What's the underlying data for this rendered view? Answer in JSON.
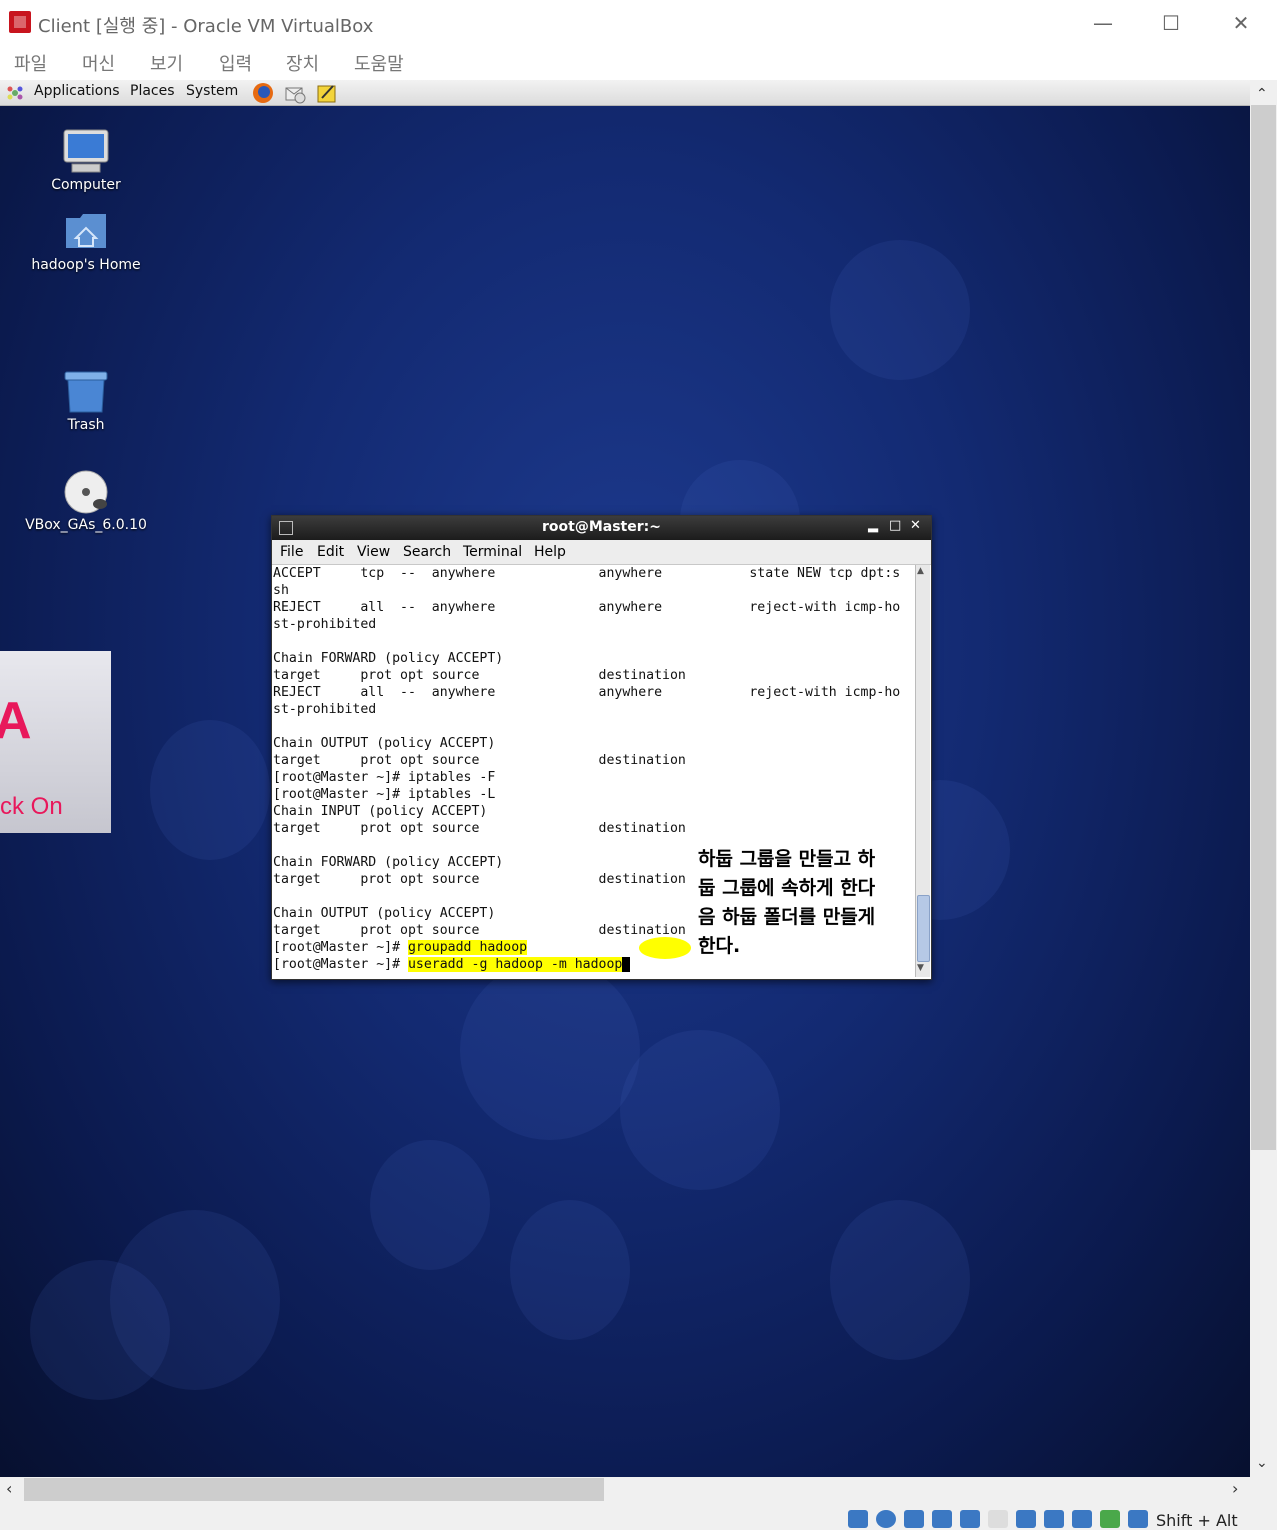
{
  "host": {
    "title": "Client [실행 중] - Oracle VM VirtualBox",
    "menu": [
      "파일",
      "머신",
      "보기",
      "입력",
      "장치",
      "도움말"
    ],
    "status_keys": "Shift + Alt"
  },
  "guest": {
    "panel": {
      "applications": "Applications",
      "places": "Places",
      "system": "System"
    },
    "desktop_icons": [
      {
        "label": "Computer",
        "icon": "computer-icon"
      },
      {
        "label": "hadoop's Home",
        "icon": "home-folder-icon"
      },
      {
        "label": "Trash",
        "icon": "trash-icon"
      },
      {
        "label": "VBox_GAs_6.0.10",
        "icon": "cd-icon"
      }
    ],
    "side_widget": {
      "big_letter": "A",
      "text": "ck On"
    }
  },
  "terminal": {
    "title": "root@Master:~",
    "menu": [
      "File",
      "Edit",
      "View",
      "Search",
      "Terminal",
      "Help"
    ],
    "lines": [
      "ACCEPT     tcp  --  anywhere             anywhere           state NEW tcp dpt:s",
      "sh",
      "REJECT     all  --  anywhere             anywhere           reject-with icmp-ho",
      "st-prohibited",
      "",
      "Chain FORWARD (policy ACCEPT)",
      "target     prot opt source               destination",
      "REJECT     all  --  anywhere             anywhere           reject-with icmp-ho",
      "st-prohibited",
      "",
      "Chain OUTPUT (policy ACCEPT)",
      "target     prot opt source               destination",
      "[root@Master ~]# iptables -F",
      "[root@Master ~]# iptables -L",
      "Chain INPUT (policy ACCEPT)",
      "target     prot opt source               destination",
      "",
      "Chain FORWARD (policy ACCEPT)",
      "target     prot opt source               destination",
      "",
      "Chain OUTPUT (policy ACCEPT)",
      "target     prot opt source               destination"
    ],
    "prompt": "[root@Master ~]# ",
    "cmd1": "groupadd hadoop",
    "cmd2": "useradd -g hadoop -m hadoop",
    "annotation": [
      "하둡 그룹을 만들고 하",
      "둡 그룹에 속하게 한다",
      "음 하둡 폴더를 만들게",
      "한다."
    ]
  }
}
